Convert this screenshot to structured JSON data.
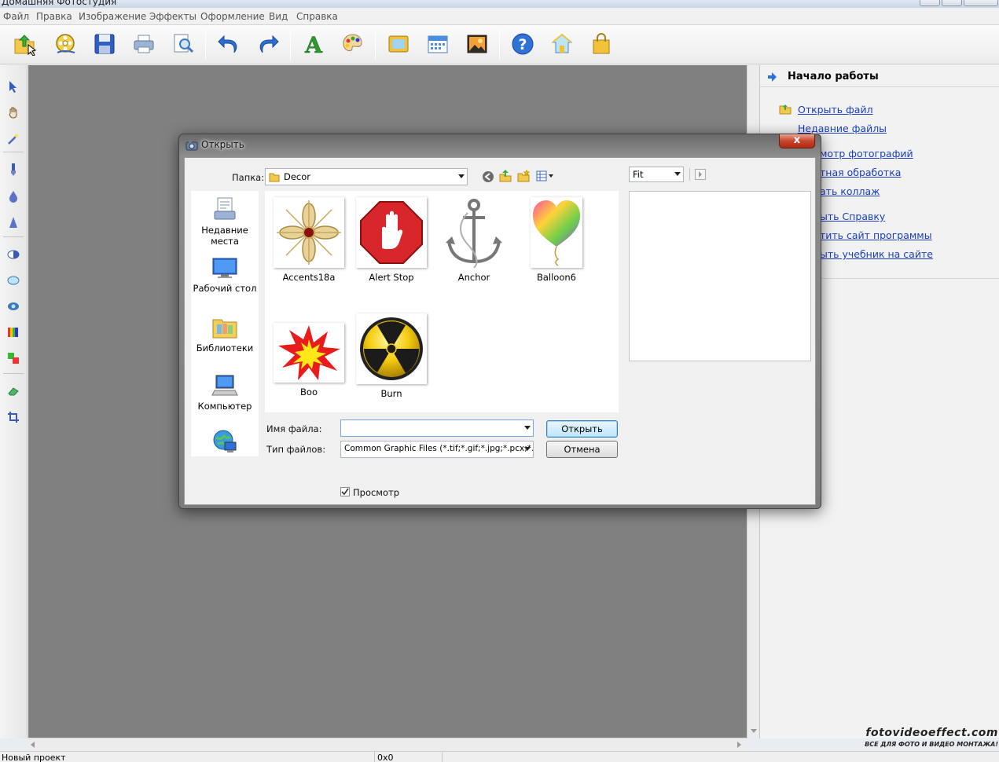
{
  "window": {
    "title": "Домашняя Фотостудия"
  },
  "menu": [
    "Файл",
    "Правка",
    "Изображение",
    "Эффекты",
    "Оформление",
    "Вид",
    "Справка"
  ],
  "toolbar": {
    "icons": [
      "open-file-icon",
      "film-reel-icon",
      "save-icon",
      "print-icon",
      "zoom-preview-icon",
      "undo-icon",
      "redo-icon",
      "text-icon",
      "palette-icon",
      "frame-icon",
      "calendar-icon",
      "photo-effect-icon",
      "help-icon",
      "home-icon",
      "shopping-bag-icon"
    ]
  },
  "right_panel": {
    "header": "Начало работы",
    "links": [
      "Открыть файл",
      "Недавние файлы",
      "мотр фотографий",
      "тная обработка",
      "ать коллаж",
      "ыть Справку",
      "тить сайт программы",
      "ыть учебник на сайте"
    ]
  },
  "status": {
    "left": "Новый проект",
    "dims": "0x0"
  },
  "watermark": {
    "line1": "fotovideoeffect.com",
    "line2": "ВСЕ ДЛЯ ФОТО И ВИДЕО МОНТАЖА!"
  },
  "dialog": {
    "title": "Открыть",
    "close": "x",
    "folder_label": "Папка:",
    "folder_value": "Decor",
    "preview_mode": "Fit",
    "places": [
      {
        "label": "Недавние места",
        "icon": "recent-places-icon"
      },
      {
        "label": "Рабочий стол",
        "icon": "desktop-icon"
      },
      {
        "label": "Библиотеки",
        "icon": "libraries-icon"
      },
      {
        "label": "Компьютер",
        "icon": "computer-icon"
      },
      {
        "label": "",
        "icon": "network-icon"
      }
    ],
    "files": [
      "Accents18a",
      "Alert Stop",
      "Anchor",
      "Balloon6",
      "Boo",
      "Burn"
    ],
    "filename_label": "Имя файла:",
    "filename_value": "",
    "filetype_label": "Тип файлов:",
    "filetype_value": "Common Graphic Files (*.tif;*.gif;*.jpg;*.pcx;*.bm",
    "open_button": "Открыть",
    "cancel_button": "Отмена",
    "preview_checkbox": "Просмотр",
    "preview_checked": true
  },
  "colors": {
    "canvas": "#808080",
    "link": "#1a3fbd",
    "close_red": "#c8452c"
  }
}
